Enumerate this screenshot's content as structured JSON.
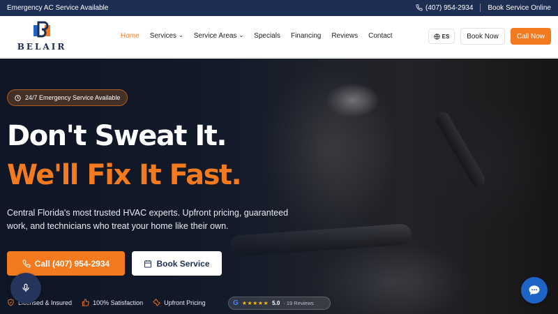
{
  "topbar": {
    "emergency_text": "Emergency AC Service Available",
    "phone": "(407) 954-2934",
    "book_link": "Book Service Online"
  },
  "logo": {
    "wordmark": "BELAIR"
  },
  "nav": {
    "items": [
      {
        "label": "Home",
        "active": true,
        "dropdown": false
      },
      {
        "label": "Services",
        "active": false,
        "dropdown": true
      },
      {
        "label": "Service Areas",
        "active": false,
        "dropdown": true
      },
      {
        "label": "Specials",
        "active": false,
        "dropdown": false
      },
      {
        "label": "Financing",
        "active": false,
        "dropdown": false
      },
      {
        "label": "Reviews",
        "active": false,
        "dropdown": false
      },
      {
        "label": "Contact",
        "active": false,
        "dropdown": false
      }
    ],
    "lang_label": "ES",
    "book_now": "Book Now",
    "call_now": "Call Now"
  },
  "hero": {
    "badge": "24/7 Emergency Service Available",
    "headline_line1": "Don't Sweat It.",
    "headline_line2": "We'll Fix It Fast.",
    "subtext": "Central Florida's most trusted HVAC experts. Upfront pricing, guaranteed work, and technicians who treat your home like their own.",
    "cta_call": "Call (407) 954-2934",
    "cta_book": "Book Service"
  },
  "trust": {
    "items": [
      "Licensed & Insured",
      "100% Satisfaction",
      "Upfront Pricing"
    ],
    "google_rating": "5.0",
    "google_stars": "★★★★★",
    "google_reviews": "· 19 Reviews"
  },
  "colors": {
    "brand_navy": "#1e2d52",
    "accent_orange": "#f47a1f",
    "chat_blue": "#1e63c6"
  },
  "icons": {
    "phone": "phone-icon",
    "globe": "globe-icon",
    "clock": "clock-icon",
    "calendar": "calendar-icon",
    "mic": "microphone-icon",
    "chat": "chat-bubble-icon",
    "shield": "shield-check-icon",
    "thumbs": "thumbs-up-icon",
    "wrench": "wrench-icon",
    "google": "google-icon"
  }
}
